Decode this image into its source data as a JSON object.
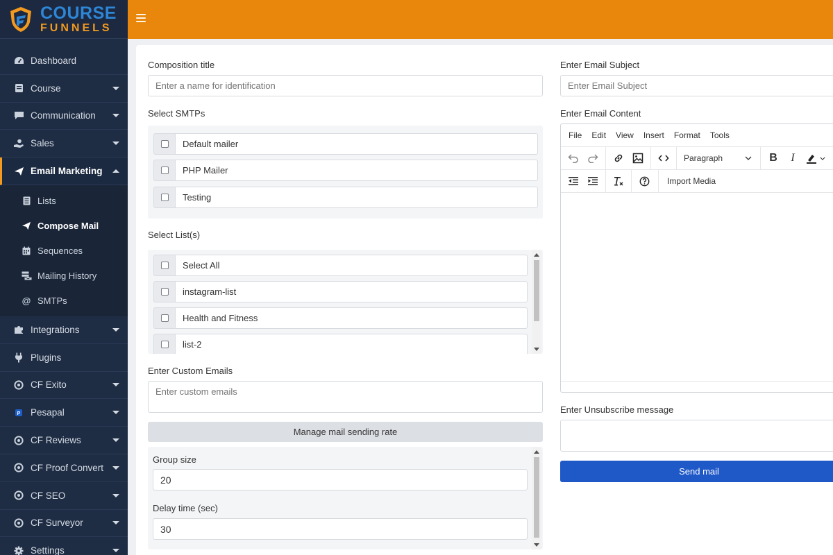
{
  "brand": {
    "line1": "COURSE",
    "line2": "FUNNELS"
  },
  "sidebar": {
    "items": [
      {
        "label": "Dashboard",
        "icon": "dashboard-icon",
        "caret": false
      },
      {
        "label": "Course",
        "icon": "book-icon",
        "caret": true
      },
      {
        "label": "Communication",
        "icon": "chat-icon",
        "caret": true
      },
      {
        "label": "Sales",
        "icon": "hand-coin-icon",
        "caret": true
      },
      {
        "label": "Email Marketing",
        "icon": "paper-plane-icon",
        "caret": true,
        "active": true
      }
    ],
    "submenu": [
      {
        "label": "Lists",
        "icon": "list-icon"
      },
      {
        "label": "Compose Mail",
        "icon": "paper-plane-icon",
        "active": true
      },
      {
        "label": "Sequences",
        "icon": "calendar-icon"
      },
      {
        "label": "Mailing History",
        "icon": "mail-stack-icon"
      },
      {
        "label": "SMTPs",
        "icon": "at-icon"
      }
    ],
    "items_after": [
      {
        "label": "Integrations",
        "icon": "puzzle-icon",
        "caret": true
      },
      {
        "label": "Plugins",
        "icon": "plug-icon",
        "caret": false
      },
      {
        "label": "CF Exito",
        "icon": "target-icon",
        "caret": true
      },
      {
        "label": "Pesapal",
        "icon": "pesapal-icon",
        "caret": true
      },
      {
        "label": "CF Reviews",
        "icon": "target-icon",
        "caret": true
      },
      {
        "label": "CF Proof Convert",
        "icon": "target-icon",
        "caret": true
      },
      {
        "label": "CF SEO",
        "icon": "target-icon",
        "caret": true
      },
      {
        "label": "CF Surveyor",
        "icon": "target-icon",
        "caret": true
      },
      {
        "label": "Settings",
        "icon": "gear-icon",
        "caret": true
      }
    ]
  },
  "form": {
    "composition_title_label": "Composition title",
    "composition_title_placeholder": "Enter a name for identification",
    "select_smtps_label": "Select SMTPs",
    "smtps": [
      "Default mailer",
      "PHP Mailer",
      "Testing"
    ],
    "select_lists_label": "Select List(s)",
    "lists": [
      "Select All",
      "instagram-list",
      "Health and Fitness",
      "list-2"
    ],
    "custom_emails_label": "Enter Custom Emails",
    "custom_emails_placeholder": "Enter custom emails",
    "manage_rate_button": "Manage mail sending rate",
    "group_size_label": "Group size",
    "group_size_value": "20",
    "delay_label": "Delay time (sec)",
    "delay_value": "30",
    "subject_label": "Enter Email Subject",
    "subject_placeholder": "Enter Email Subject",
    "content_label": "Enter Email Content",
    "unsubscribe_label": "Enter Unsubscribe message",
    "send_button": "Send mail"
  },
  "editor": {
    "menu": [
      "File",
      "Edit",
      "View",
      "Insert",
      "Format",
      "Tools"
    ],
    "format_select": "Paragraph",
    "import_media": "Import Media"
  },
  "colors": {
    "topbar": "#e8870c",
    "sidebar": "#1f2d44",
    "accent_blue": "#1f58c7",
    "brand_blue": "#2e86d6",
    "brand_orange": "#f29a1f"
  }
}
